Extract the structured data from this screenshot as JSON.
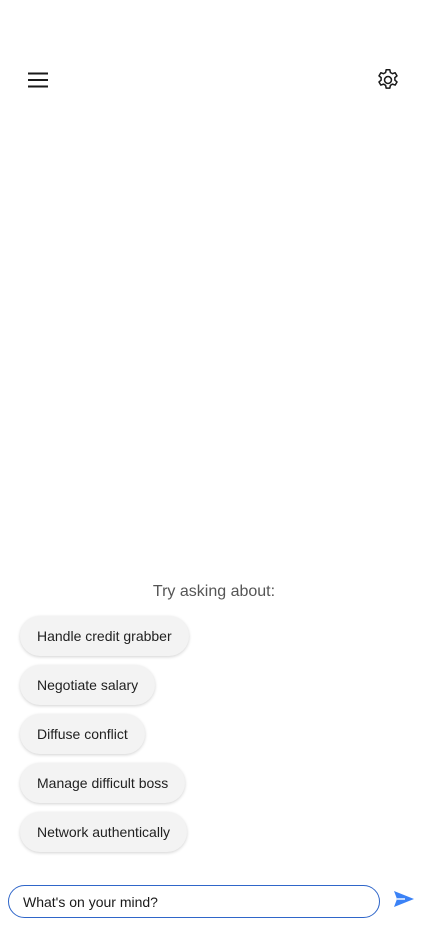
{
  "header": {
    "menu_icon": "hamburger-menu-icon",
    "settings_icon": "gear-icon"
  },
  "suggestions": {
    "title": "Try asking about:",
    "items": [
      {
        "label": "Handle credit grabber"
      },
      {
        "label": "Negotiate salary"
      },
      {
        "label": "Diffuse conflict"
      },
      {
        "label": "Manage difficult boss"
      },
      {
        "label": "Network authentically"
      }
    ]
  },
  "composer": {
    "placeholder": "What's on your mind?",
    "value": "",
    "send_icon": "send-arrow-icon"
  },
  "colors": {
    "accent": "#2f66c9",
    "send": "#3b82f6",
    "chip_bg": "#f3f3f3"
  }
}
